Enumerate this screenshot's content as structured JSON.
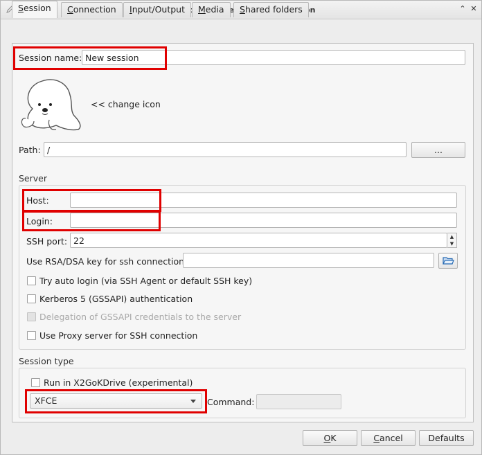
{
  "window": {
    "title": "Session preferences - New session",
    "controls": {
      "minimize": "⌃",
      "close": "✕"
    }
  },
  "tabs": [
    {
      "label": "Session",
      "mnemonic": "S",
      "rest": "ession",
      "active": true
    },
    {
      "label": "Connection",
      "mnemonic": "C",
      "rest": "onnection"
    },
    {
      "label": "Input/Output",
      "mnemonic": "I",
      "rest": "nput/Output"
    },
    {
      "label": "Media",
      "mnemonic": "M",
      "rest": "edia"
    },
    {
      "label": "Shared folders",
      "mnemonic": "S",
      "rest": "hared folders"
    }
  ],
  "session": {
    "name_label": "Session name:",
    "name_value": "New session",
    "change_icon_label": "<< change icon",
    "path_label": "Path:",
    "path_value": "/",
    "browse_label": "..."
  },
  "server": {
    "section_title": "Server",
    "host_label": "Host:",
    "host_value": "",
    "login_label": "Login:",
    "login_value": "",
    "ssh_port_label": "SSH port:",
    "ssh_port_value": "22",
    "rsa_label": "Use RSA/DSA key for ssh connection:",
    "rsa_value": "",
    "checkboxes": [
      {
        "label": "Try auto login (via SSH Agent or default SSH key)",
        "checked": false,
        "disabled": false
      },
      {
        "label": "Kerberos 5 (GSSAPI) authentication",
        "checked": false,
        "disabled": false
      },
      {
        "label": "Delegation of GSSAPI credentials to the server",
        "checked": false,
        "disabled": true
      },
      {
        "label": "Use Proxy server for SSH connection",
        "checked": false,
        "disabled": false
      }
    ]
  },
  "session_type": {
    "section_title": "Session type",
    "x2gokdrive_label": "Run in X2GoKDrive (experimental)",
    "type_value": "XFCE",
    "command_label": "Command:",
    "command_value": ""
  },
  "buttons": {
    "ok": {
      "mnemonic": "O",
      "rest": "K"
    },
    "cancel": {
      "mnemonic": "C",
      "rest": "ancel"
    },
    "defaults": "Defaults"
  },
  "colors": {
    "highlight": "#e00000",
    "link_icon": "#2a6db5"
  }
}
